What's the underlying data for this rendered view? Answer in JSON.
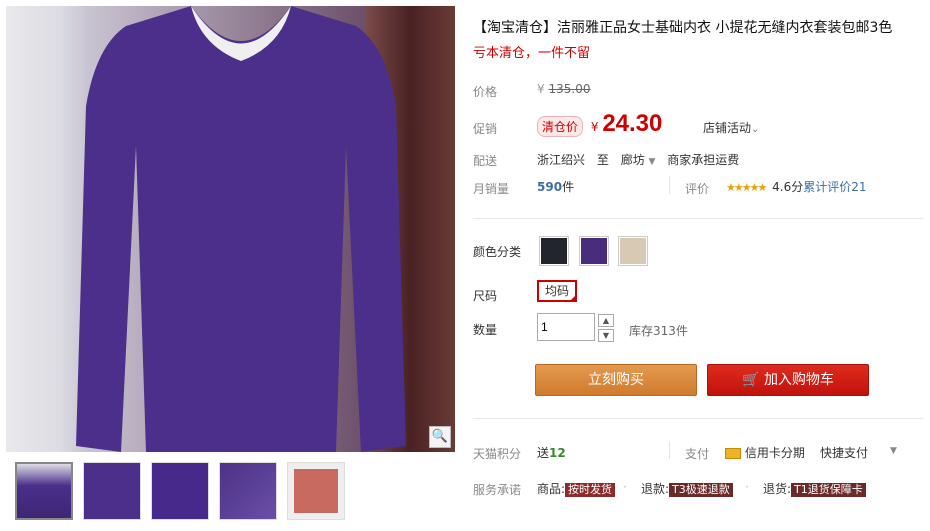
{
  "product": {
    "title": "【淘宝清仓】洁丽雅正品女士基础内衣 小提花无缝内衣套装包邮3色",
    "subtitle": "亏本清仓，一件不留"
  },
  "price": {
    "label": "价格",
    "currency": "¥",
    "original": "135.00"
  },
  "promo": {
    "label": "促销",
    "tag": "清仓价",
    "currency": "¥",
    "value": "24.30",
    "store_activity": "店铺活动"
  },
  "delivery": {
    "label": "配送",
    "from": "浙江绍兴",
    "to_word": "至",
    "destination": "廊坊",
    "shipping": "商家承担运费"
  },
  "sales": {
    "label": "月销量",
    "count": "590",
    "unit": "件",
    "review_label": "评价",
    "stars": 4.6,
    "score": "4.6分",
    "total_reviews_text": "累计评价21"
  },
  "colors": {
    "label": "颜色分类",
    "options": [
      "black",
      "purple",
      "beige"
    ],
    "swatches": [
      "#22252e",
      "#4a2c7c",
      "#d8c9b5"
    ]
  },
  "size": {
    "label": "尺码",
    "value": "均码"
  },
  "quantity": {
    "label": "数量",
    "value": "1",
    "stock": "库存313件"
  },
  "buttons": {
    "buy_now": "立刻购买",
    "add_cart": "加入购物车"
  },
  "points": {
    "label": "天猫积分",
    "text": "送",
    "value": "12",
    "pay_label": "支付",
    "credit": "信用卡分期",
    "quick_pay": "快捷支付"
  },
  "service": {
    "label": "服务承诺",
    "items": [
      {
        "prefix": "商品:",
        "badge": "按时发货"
      },
      {
        "prefix": "退款:",
        "badge": "T3极速退款"
      },
      {
        "prefix": "退货:",
        "badge": "T1退货保障卡"
      }
    ]
  },
  "colors_theme": {
    "accent_red": "#cc0000",
    "buy_orange": "#d9853a",
    "cart_red": "#d11c14"
  }
}
